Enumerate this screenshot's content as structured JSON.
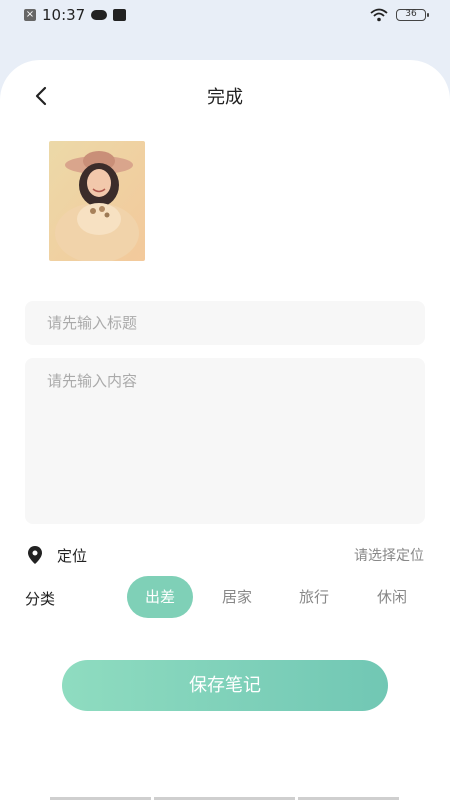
{
  "status_bar": {
    "time": "10:37",
    "battery": "36"
  },
  "header": {
    "title": "完成"
  },
  "form": {
    "title_placeholder": "请先输入标题",
    "content_placeholder": "请先输入内容"
  },
  "location": {
    "label": "定位",
    "action": "请选择定位"
  },
  "category": {
    "label": "分类",
    "options": [
      "出差",
      "居家",
      "旅行",
      "休闲"
    ],
    "selected": "出差"
  },
  "save_button": "保存笔记",
  "colors": {
    "accent": "#7fd0b7",
    "placeholder": "#aaaaaa"
  },
  "icons": [
    "back-arrow-icon",
    "location-pin-icon",
    "wifi-icon",
    "battery-icon"
  ]
}
